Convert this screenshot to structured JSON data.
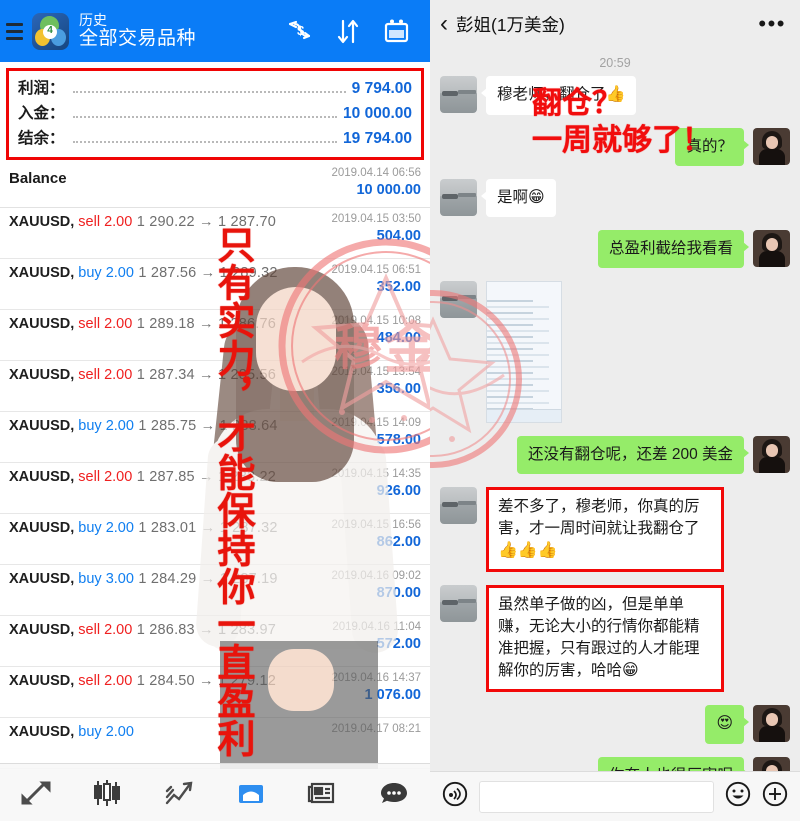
{
  "mt4": {
    "header": {
      "title_top": "历史",
      "title_main": "全部交易品种",
      "menu_icon": "hamburger-menu-icon",
      "app_badge": "4",
      "icons": [
        "currency-exchange-icon",
        "sort-arrows-icon",
        "calendar-icon"
      ]
    },
    "summary": [
      {
        "label": "利润：",
        "value": "9 794.00"
      },
      {
        "label": "入金：",
        "value": "10 000.00"
      },
      {
        "label": "结余：",
        "value": "19 794.00"
      }
    ],
    "balance_row": {
      "label": "Balance",
      "date": "2019.04.14 06:56",
      "amount": "10 000.00"
    },
    "trades": [
      {
        "symbol": "XAUUSD,",
        "side": "sell",
        "lots": "2.00",
        "open": "1 290.22",
        "close": "1 287.70",
        "date": "2019.04.15 03:50",
        "profit": "504.00"
      },
      {
        "symbol": "XAUUSD,",
        "side": "buy",
        "lots": "2.00",
        "open": "1 287.56",
        "close": "1 289.32",
        "date": "2019.04.15 06:51",
        "profit": "352.00"
      },
      {
        "symbol": "XAUUSD,",
        "side": "sell",
        "lots": "2.00",
        "open": "1 289.18",
        "close": "1 286.76",
        "date": "2019.04.15 10:08",
        "profit": "484.00"
      },
      {
        "symbol": "XAUUSD,",
        "side": "sell",
        "lots": "2.00",
        "open": "1 287.34",
        "close": "1 285.56",
        "date": "2019.04.15 13:54",
        "profit": "356.00"
      },
      {
        "symbol": "XAUUSD,",
        "side": "buy",
        "lots": "2.00",
        "open": "1 285.75",
        "close": "1 288.64",
        "date": "2019.04.15 14:09",
        "profit": "578.00"
      },
      {
        "symbol": "XAUUSD,",
        "side": "sell",
        "lots": "2.00",
        "open": "1 287.85",
        "close": "1 283.22",
        "date": "2019.04.15 14:35",
        "profit": "926.00"
      },
      {
        "symbol": "XAUUSD,",
        "side": "buy",
        "lots": "2.00",
        "open": "1 283.01",
        "close": "1 287.32",
        "date": "2019.04.15 16:56",
        "profit": "862.00"
      },
      {
        "symbol": "XAUUSD,",
        "side": "buy",
        "lots": "3.00",
        "open": "1 284.29",
        "close": "1 287.19",
        "date": "2019.04.16 09:02",
        "profit": "870.00"
      },
      {
        "symbol": "XAUUSD,",
        "side": "sell",
        "lots": "2.00",
        "open": "1 286.83",
        "close": "1 283.97",
        "date": "2019.04.16 11:04",
        "profit": "572.00"
      },
      {
        "symbol": "XAUUSD,",
        "side": "sell",
        "lots": "2.00",
        "open": "1 284.50",
        "close": "1 279.12",
        "date": "2019.04.16 14:37",
        "profit": "1 076.00"
      },
      {
        "symbol": "XAUUSD,",
        "side": "buy",
        "lots": "2.00",
        "open": "",
        "close": "",
        "date": "2019.04.17 08:21",
        "profit": ""
      }
    ],
    "slogan_vertical": "只有实力，才能保持你一直盈利",
    "stamp_text": "穆",
    "bottom_nav": [
      {
        "name": "quotes-icon"
      },
      {
        "name": "candlestick-chart-icon"
      },
      {
        "name": "trend-chart-icon"
      },
      {
        "name": "trade-inbox-icon"
      },
      {
        "name": "news-icon"
      },
      {
        "name": "chat-icon"
      }
    ]
  },
  "wechat": {
    "header": {
      "back_icon": "back-chevron-icon",
      "contact_name": "彭姐(1万美金)",
      "more_icon": "more-dots-icon"
    },
    "timestamp": "20:59",
    "messages": [
      {
        "dir": "in",
        "type": "text",
        "text": "穆老师，翻仓了",
        "emoji": "👍",
        "boxed": false
      },
      {
        "dir": "out",
        "type": "text",
        "text": "真的？",
        "emoji": "",
        "boxed": false
      },
      {
        "dir": "in",
        "type": "text",
        "text": "是啊",
        "emoji": "😁",
        "boxed": false
      },
      {
        "dir": "out",
        "type": "text",
        "text": "总盈利截给我看看",
        "emoji": "",
        "boxed": false
      },
      {
        "dir": "in",
        "type": "image",
        "text": "",
        "emoji": "",
        "boxed": false
      },
      {
        "dir": "out",
        "type": "text",
        "text": "还没有翻仓呢，还差 200 美金",
        "emoji": "",
        "boxed": false
      },
      {
        "dir": "in",
        "type": "text",
        "text": "差不多了，穆老师，你真的厉害，才一周时间就让我翻仓了",
        "emoji": "👍👍👍",
        "boxed": true
      },
      {
        "dir": "in",
        "type": "text",
        "text": "虽然单子做的凶，但是单单赚，无论大小的行情你都能精准把握，只有跟过的人才能理解你的厉害，哈哈",
        "emoji": "😁",
        "boxed": true
      },
      {
        "dir": "out",
        "type": "text",
        "text": "",
        "emoji": "😍",
        "boxed": false
      },
      {
        "dir": "out",
        "type": "text",
        "text": "你夸人也很厉害呢",
        "emoji": "",
        "boxed": false
      }
    ],
    "red_overlay_line1": "翻仓？",
    "red_overlay_line2": "一周就够了！",
    "input_bar": {
      "voice_icon": "voice-record-icon",
      "input_value": "",
      "input_placeholder": "",
      "emoji_icon": "emoji-smiley-icon",
      "plus_icon": "plus-more-icon"
    }
  },
  "colors": {
    "mt4_header_blue": "#0a7cf7",
    "value_blue": "#1166d8",
    "sell_red": "#ef2020",
    "buy_blue": "#0f7ef0",
    "alert_red": "#f20808",
    "wechat_green": "#95ec69",
    "wechat_bg": "#ededed"
  }
}
